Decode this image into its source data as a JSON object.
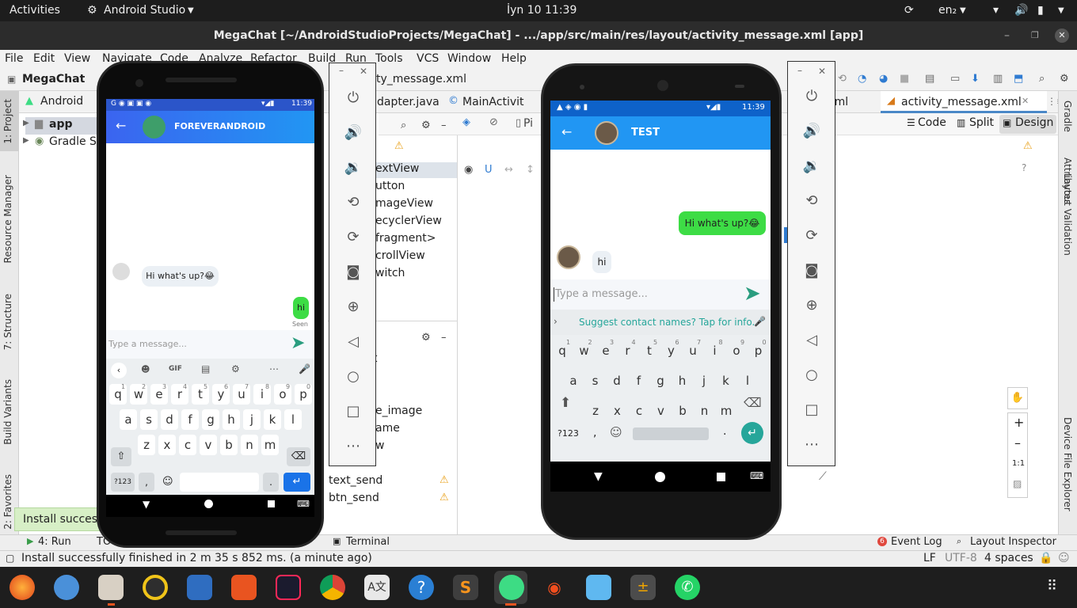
{
  "topbar": {
    "activities": "Activities",
    "app": "Android Studio",
    "clock": "İyn 10  11:39",
    "lang": "en₂"
  },
  "window": {
    "title": "MegaChat [~/AndroidStudioProjects/MegaChat] - .../app/src/main/res/layout/activity_message.xml [app]"
  },
  "menu": [
    "File",
    "Edit",
    "View",
    "Navigate",
    "Code",
    "Analyze",
    "Refactor",
    "Build",
    "Run",
    "Tools",
    "VCS",
    "Window",
    "Help"
  ],
  "breadcrumb": {
    "project": "MegaChat",
    "file": "ty_message.xml"
  },
  "project_panel": {
    "view": "Android",
    "items": [
      "app",
      "Gradle Sc"
    ]
  },
  "editor_tabs": {
    "tab1": "dapter.java",
    "tab2": "MainActivit",
    "tab3": "n.xml",
    "tab4": "activity_message.xml"
  },
  "design_modes": {
    "code": "Code",
    "split": "Split",
    "design": "Design"
  },
  "palette": [
    "extView",
    "utton",
    "mageView",
    "ecyclerView",
    "fragment>",
    "crollView",
    "witch"
  ],
  "component_tree": [
    "t",
    "e_image",
    "ame",
    "w",
    "text_send",
    "btn_send"
  ],
  "left_strip": [
    "1: Project",
    "Resource Manager",
    "7: Structure",
    "Build Variants",
    "2: Favorites"
  ],
  "right_strip": [
    "Gradle",
    "Attributes",
    "Layout Validation",
    "Device File Explorer"
  ],
  "toast": "Install success",
  "bottom_tabs": {
    "run": "4: Run",
    "todo": "TO",
    "terminal": "Terminal",
    "event_log": "Event Log",
    "layout_inspector": "Layout Inspector"
  },
  "status": {
    "message": "Install successfully finished in 2 m 35 s 852 ms. (a minute ago)",
    "line_sep": "LF",
    "encoding": "UTF-8",
    "indent": "4 spaces"
  },
  "zoom": {
    "ratio": "1:1"
  },
  "phone1": {
    "time": "11:39",
    "header": "FOREVERANDROID",
    "incoming": "Hi what's up?😂",
    "outgoing": "hi",
    "seen": "Seen",
    "placeholder": "Type a message...",
    "kb_row0": [
      "q",
      "w",
      "e",
      "r",
      "t",
      "y",
      "u",
      "i",
      "o",
      "p"
    ],
    "kb_row0_sup": [
      "1",
      "2",
      "3",
      "4",
      "5",
      "6",
      "7",
      "8",
      "9",
      "0"
    ],
    "kb_row1": [
      "a",
      "s",
      "d",
      "f",
      "g",
      "h",
      "j",
      "k",
      "l"
    ],
    "kb_row2": [
      "z",
      "x",
      "c",
      "v",
      "b",
      "n",
      "m"
    ],
    "kb_sym": "?123",
    "kb_comma": ",",
    "kb_dot": ".",
    "kb_gif": "GIF"
  },
  "phone2": {
    "time": "11:39",
    "header": "TEST",
    "outgoing": "Hi what's up?😂",
    "incoming": "hi",
    "placeholder": "Type a message...",
    "suggest": "Suggest contact names? Tap for info.",
    "kb_row0": [
      "q",
      "w",
      "e",
      "r",
      "t",
      "y",
      "u",
      "i",
      "o",
      "p"
    ],
    "kb_row0_sup": [
      "1",
      "2",
      "3",
      "4",
      "5",
      "6",
      "7",
      "8",
      "9",
      "0"
    ],
    "kb_row1": [
      "a",
      "s",
      "d",
      "f",
      "g",
      "h",
      "j",
      "k",
      "l"
    ],
    "kb_row2": [
      "z",
      "x",
      "c",
      "v",
      "b",
      "n",
      "m"
    ],
    "kb_sym": "?123",
    "kb_comma": ",",
    "kb_dot": "."
  },
  "colors": {
    "app_bar_start": "#3b64f0",
    "app_bar_end": "#2196f3",
    "bubble_green": "#3ddc45",
    "bubble_gray": "#ebf0f5",
    "accent": "#26a69a"
  }
}
